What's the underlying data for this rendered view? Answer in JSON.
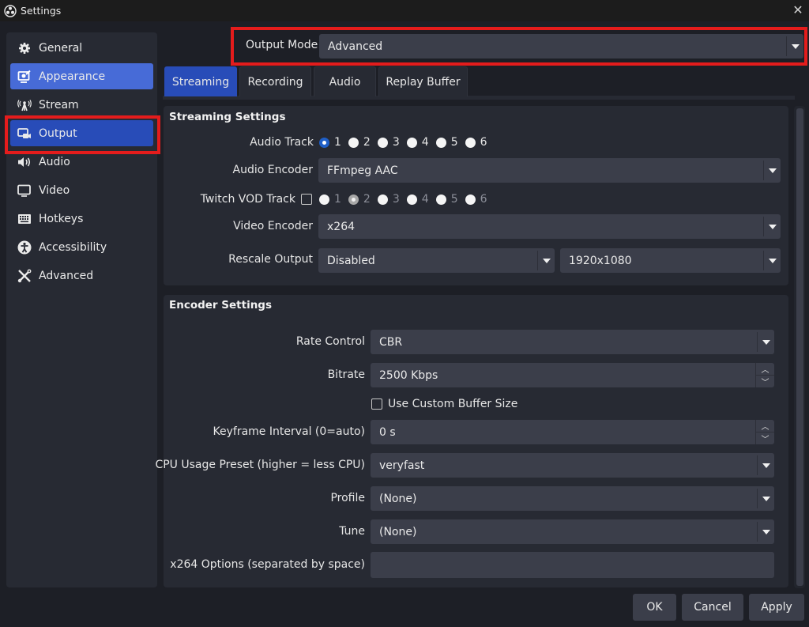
{
  "window": {
    "title": "Settings",
    "close_icon": "close-icon"
  },
  "sidebar": {
    "items": [
      {
        "label": "General",
        "icon": "gear-icon"
      },
      {
        "label": "Appearance",
        "icon": "appearance-icon",
        "state": "hover"
      },
      {
        "label": "Stream",
        "icon": "antenna-icon"
      },
      {
        "label": "Output",
        "icon": "output-icon",
        "state": "selected"
      },
      {
        "label": "Audio",
        "icon": "speaker-icon"
      },
      {
        "label": "Video",
        "icon": "monitor-icon"
      },
      {
        "label": "Hotkeys",
        "icon": "keyboard-icon"
      },
      {
        "label": "Accessibility",
        "icon": "accessibility-icon"
      },
      {
        "label": "Advanced",
        "icon": "tools-icon"
      }
    ]
  },
  "output_mode": {
    "label": "Output Mode",
    "value": "Advanced"
  },
  "tabs": [
    {
      "label": "Streaming",
      "active": true
    },
    {
      "label": "Recording"
    },
    {
      "label": "Audio"
    },
    {
      "label": "Replay Buffer"
    }
  ],
  "streaming_settings": {
    "title": "Streaming Settings",
    "audio_track": {
      "label": "Audio Track",
      "options": [
        "1",
        "2",
        "3",
        "4",
        "5",
        "6"
      ],
      "selected": "1"
    },
    "audio_encoder": {
      "label": "Audio Encoder",
      "value": "FFmpeg AAC"
    },
    "twitch_vod": {
      "label": "Twitch VOD Track",
      "checked": false,
      "options": [
        "1",
        "2",
        "3",
        "4",
        "5",
        "6"
      ],
      "selected": "2",
      "disabled": true
    },
    "video_encoder": {
      "label": "Video Encoder",
      "value": "x264"
    },
    "rescale_output": {
      "label": "Rescale Output",
      "value": "Disabled",
      "resolution": "1920x1080"
    }
  },
  "encoder_settings": {
    "title": "Encoder Settings",
    "rate_control": {
      "label": "Rate Control",
      "value": "CBR"
    },
    "bitrate": {
      "label": "Bitrate",
      "value": "2500 Kbps"
    },
    "custom_buffer": {
      "label": "Use Custom Buffer Size",
      "checked": false
    },
    "keyframe": {
      "label": "Keyframe Interval (0=auto)",
      "value": "0 s"
    },
    "cpu_preset": {
      "label": "CPU Usage Preset (higher = less CPU)",
      "value": "veryfast"
    },
    "profile": {
      "label": "Profile",
      "value": "(None)"
    },
    "tune": {
      "label": "Tune",
      "value": "(None)"
    },
    "x264_options": {
      "label": "x264 Options (separated by space)",
      "value": ""
    }
  },
  "buttons": {
    "ok": "OK",
    "cancel": "Cancel",
    "apply": "Apply"
  },
  "colors": {
    "accent": "#284cb8",
    "hover": "#476bd7",
    "highlight_outline": "#e41c1c",
    "radio_checked": "#1f5fc7"
  }
}
